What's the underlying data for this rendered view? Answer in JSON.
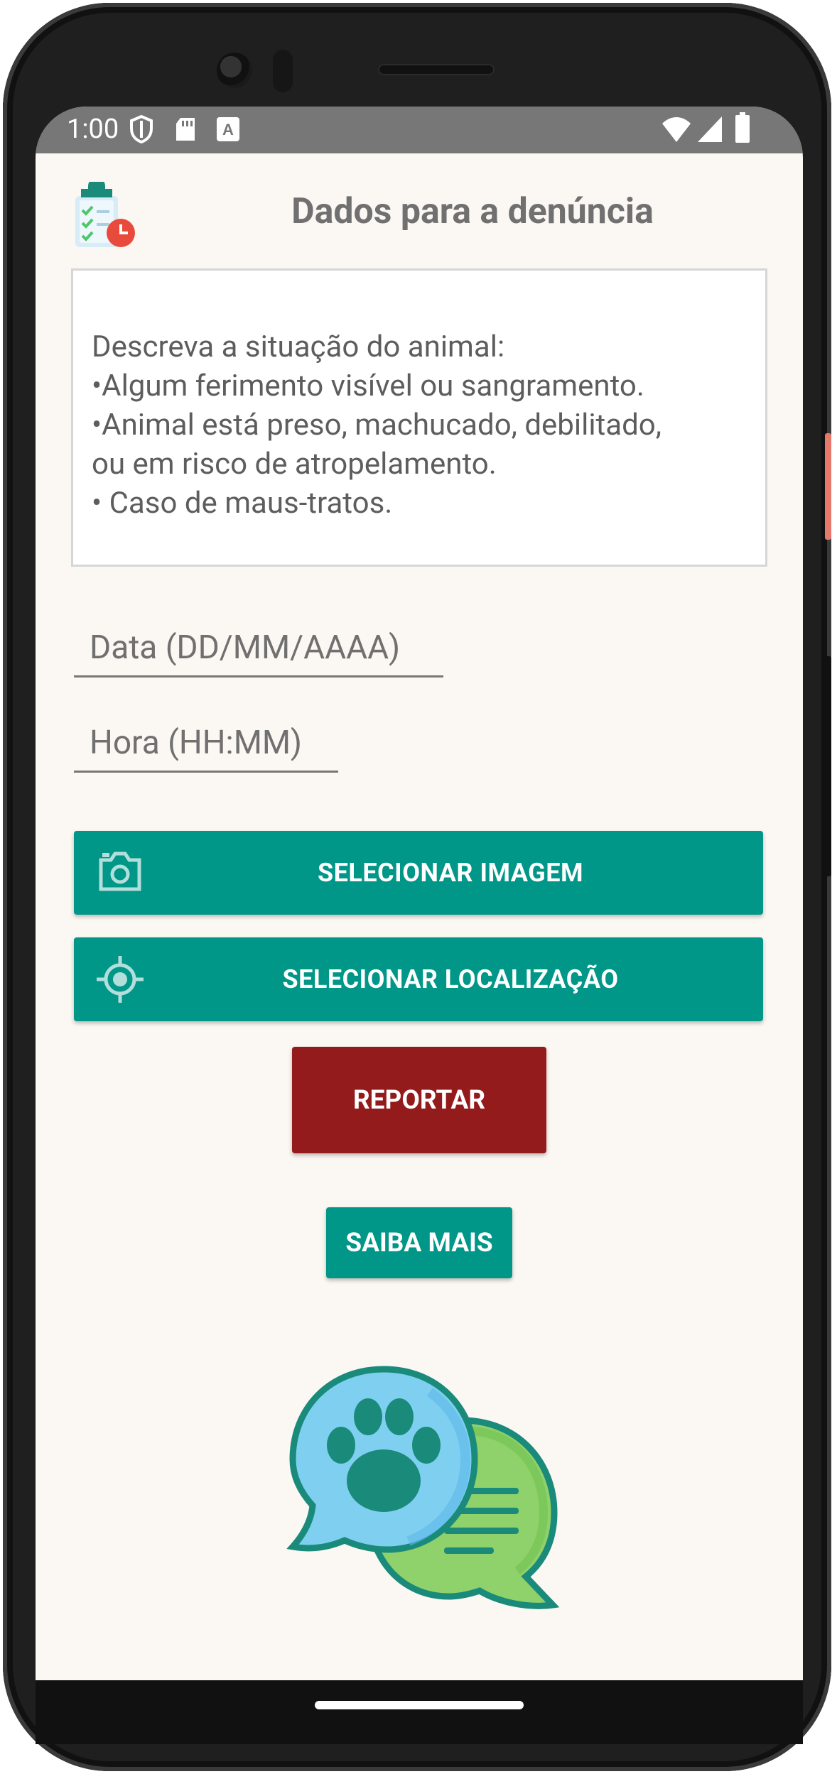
{
  "status_bar": {
    "time": "1:00",
    "icons": [
      "shield-icon",
      "sd-card-icon",
      "keyboard-a-icon",
      "wifi-icon",
      "signal-icon",
      "battery-icon"
    ]
  },
  "header": {
    "title": "Dados para a denúncia",
    "icon": "clipboard-checklist-clock-icon"
  },
  "description": {
    "lines": [
      "Descreva a situação do animal:",
      "•Algum ferimento visível ou sangramento.",
      "•Animal está preso, machucado, debilitado,",
      "ou em risco de atropelamento.",
      "• Caso de maus-tratos."
    ]
  },
  "form": {
    "date_placeholder": "Data (DD/MM/AAAA)",
    "time_placeholder": "Hora (HH:MM)"
  },
  "buttons": {
    "select_image": "SELECIONAR IMAGEM",
    "select_location": "SELECIONAR LOCALIZAÇÃO",
    "report": "REPORTAR",
    "learn_more": "SAIBA MAIS"
  },
  "illustration": "paw-chat-bubbles-icon",
  "colors": {
    "teal": "#009688",
    "report_red": "#931b1b",
    "background": "#fbf7f2",
    "status_bar": "#777777"
  }
}
